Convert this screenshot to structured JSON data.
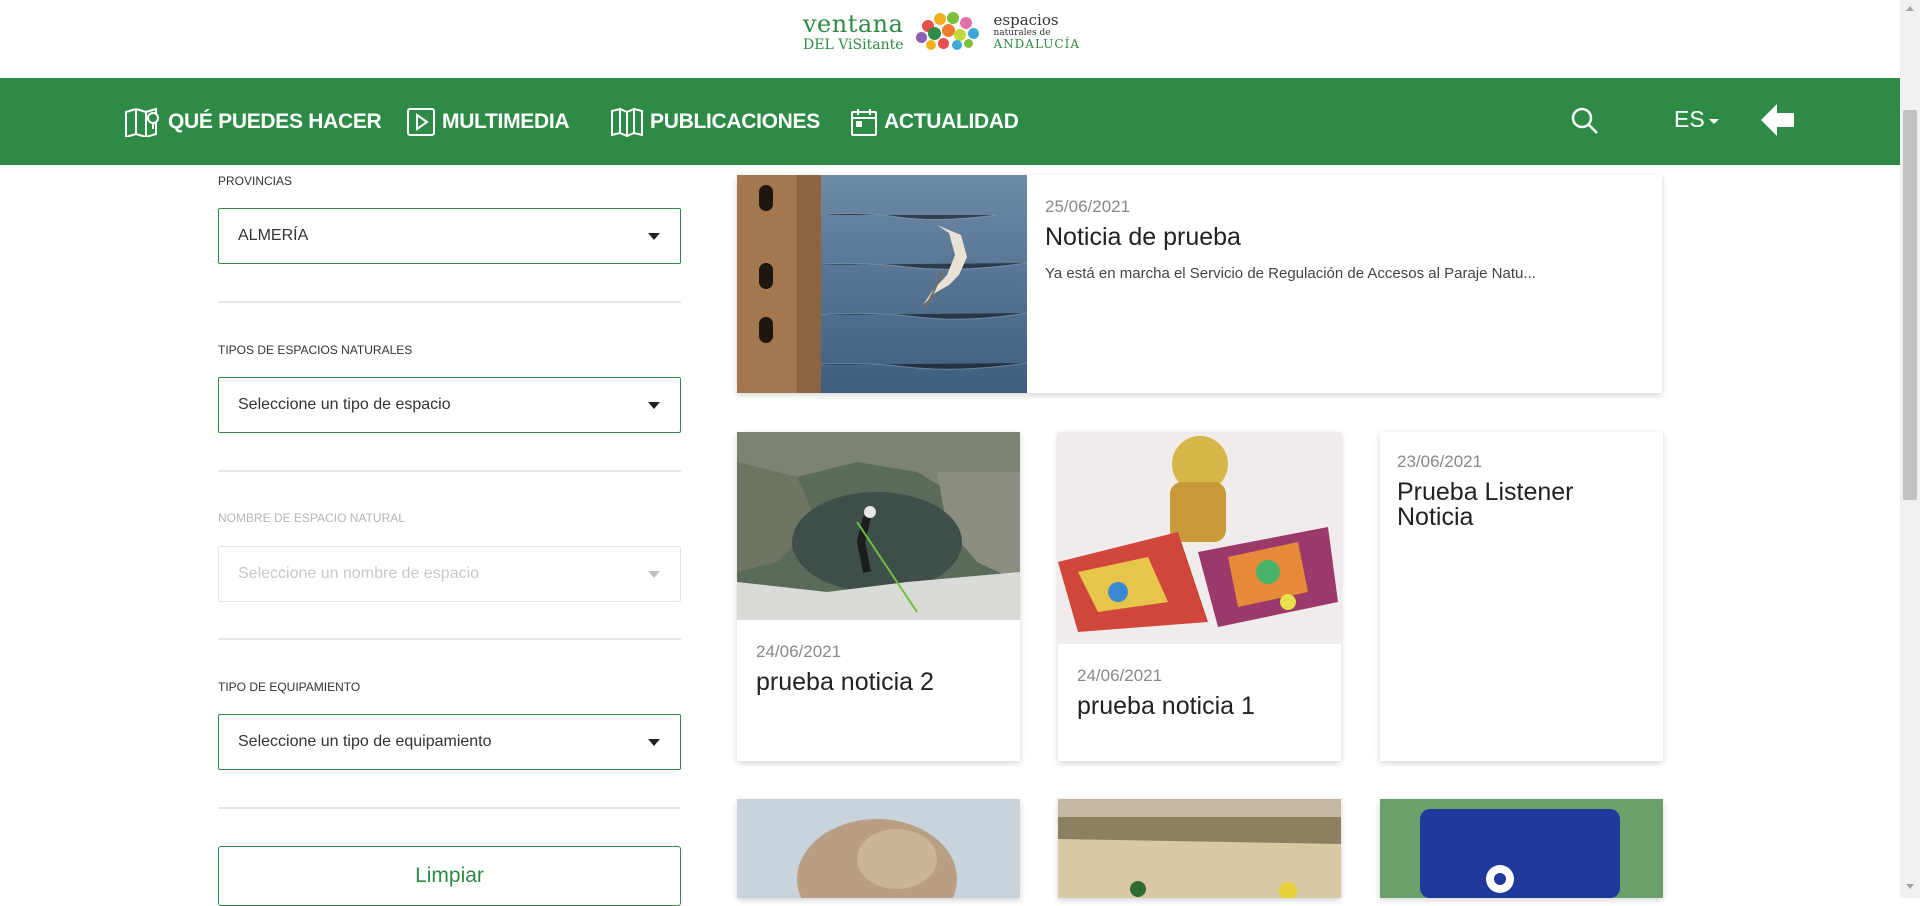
{
  "logo": {
    "line1": "ventana",
    "line2": "DEL ViSitante",
    "right1": "espacios",
    "right2": "naturales de",
    "right3": "ANDALUCÍA"
  },
  "nav": {
    "items": [
      {
        "label": "QUÉ PUEDES HACER",
        "icon": "map-pin-icon"
      },
      {
        "label": "MULTIMEDIA",
        "icon": "play-icon"
      },
      {
        "label": "PUBLICACIONES",
        "icon": "book-icon"
      },
      {
        "label": "ACTUALIDAD",
        "icon": "calendar-icon"
      }
    ],
    "language": "ES"
  },
  "filters": {
    "provincias": {
      "label": "PROVINCIAS",
      "value": "ALMERÍA"
    },
    "tipos": {
      "label": "TIPOS DE ESPACIOS NATURALES",
      "value": "Seleccione un tipo de espacio"
    },
    "nombre": {
      "label": "NOMBRE DE ESPACIO NATURAL",
      "value": "Seleccione un nombre de espacio"
    },
    "equipamiento": {
      "label": "TIPO DE EQUIPAMIENTO",
      "value": "Seleccione un tipo de equipamiento"
    },
    "clear_label": "Limpiar"
  },
  "news": {
    "featured": {
      "date": "25/06/2021",
      "title": "Noticia de prueba",
      "excerpt": "Ya está en marcha el Servicio de Regulación de Accesos al Paraje Natu..."
    },
    "cards": [
      {
        "date": "24/06/2021",
        "title": "prueba noticia 2"
      },
      {
        "date": "24/06/2021",
        "title": "prueba noticia 1"
      },
      {
        "date": "23/06/2021",
        "title": "Prueba Listener Noticia"
      }
    ]
  },
  "colors": {
    "brand_green": "#2e8b45"
  }
}
